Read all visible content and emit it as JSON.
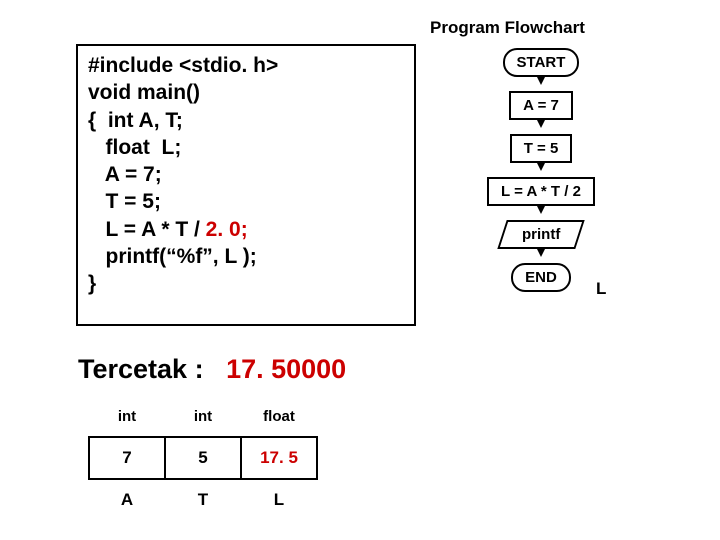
{
  "title": "Program Flowchart",
  "code": {
    "l1": "#include <stdio. h>",
    "l2": "void  main()",
    "l3": "{  int A, T;",
    "l4": "   float  L;",
    "l5": "   A = 7;",
    "l6": "   T = 5;",
    "l7a": "   L = A * T / ",
    "l7b": "2. 0;",
    "l8": "   printf(“%f”, L );",
    "l9": "}"
  },
  "flowchart": {
    "n1": "START",
    "n2": "A = 7",
    "n3": "T = 5",
    "n4": "L = A * T / 2",
    "n5": "printf",
    "n5_side": "L",
    "n6": "END"
  },
  "output": {
    "label": "Tercetak  :",
    "value": "17. 50000"
  },
  "table": {
    "h1": "int",
    "h2": "int",
    "h3": "float",
    "v1": "7",
    "v2": "5",
    "v3": "17. 5",
    "f1": "A",
    "f2": "T",
    "f3": "L"
  }
}
